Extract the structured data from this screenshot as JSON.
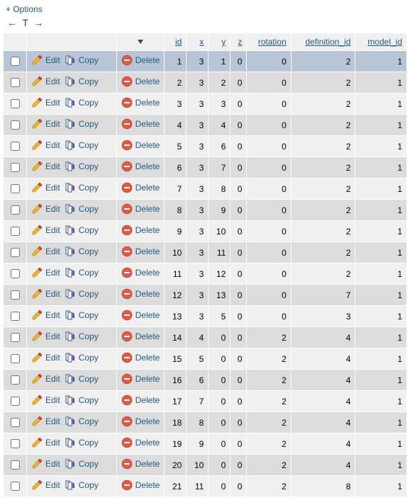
{
  "optionsLabel": "+ Options",
  "toolbar": {
    "leftArrow": "←",
    "tSymbol": "T",
    "rightArrow": "→"
  },
  "actions": {
    "edit": "Edit",
    "copy": "Copy",
    "delete": "Delete"
  },
  "columns": [
    "id",
    "x",
    "y",
    "z",
    "rotation",
    "definition_id",
    "model_id"
  ],
  "highlightRow": 0,
  "rows": [
    {
      "id": 1,
      "x": 3,
      "y": 1,
      "z": 0,
      "rotation": 0,
      "definition_id": 2,
      "model_id": 1
    },
    {
      "id": 2,
      "x": 3,
      "y": 2,
      "z": 0,
      "rotation": 0,
      "definition_id": 2,
      "model_id": 1
    },
    {
      "id": 3,
      "x": 3,
      "y": 3,
      "z": 0,
      "rotation": 0,
      "definition_id": 2,
      "model_id": 1
    },
    {
      "id": 4,
      "x": 3,
      "y": 4,
      "z": 0,
      "rotation": 0,
      "definition_id": 2,
      "model_id": 1
    },
    {
      "id": 5,
      "x": 3,
      "y": 6,
      "z": 0,
      "rotation": 0,
      "definition_id": 2,
      "model_id": 1
    },
    {
      "id": 6,
      "x": 3,
      "y": 7,
      "z": 0,
      "rotation": 0,
      "definition_id": 2,
      "model_id": 1
    },
    {
      "id": 7,
      "x": 3,
      "y": 8,
      "z": 0,
      "rotation": 0,
      "definition_id": 2,
      "model_id": 1
    },
    {
      "id": 8,
      "x": 3,
      "y": 9,
      "z": 0,
      "rotation": 0,
      "definition_id": 2,
      "model_id": 1
    },
    {
      "id": 9,
      "x": 3,
      "y": 10,
      "z": 0,
      "rotation": 0,
      "definition_id": 2,
      "model_id": 1
    },
    {
      "id": 10,
      "x": 3,
      "y": 11,
      "z": 0,
      "rotation": 0,
      "definition_id": 2,
      "model_id": 1
    },
    {
      "id": 11,
      "x": 3,
      "y": 12,
      "z": 0,
      "rotation": 0,
      "definition_id": 2,
      "model_id": 1
    },
    {
      "id": 12,
      "x": 3,
      "y": 13,
      "z": 0,
      "rotation": 0,
      "definition_id": 7,
      "model_id": 1
    },
    {
      "id": 13,
      "x": 3,
      "y": 5,
      "z": 0,
      "rotation": 0,
      "definition_id": 3,
      "model_id": 1
    },
    {
      "id": 14,
      "x": 4,
      "y": 0,
      "z": 0,
      "rotation": 2,
      "definition_id": 4,
      "model_id": 1
    },
    {
      "id": 15,
      "x": 5,
      "y": 0,
      "z": 0,
      "rotation": 2,
      "definition_id": 4,
      "model_id": 1
    },
    {
      "id": 16,
      "x": 6,
      "y": 0,
      "z": 0,
      "rotation": 2,
      "definition_id": 4,
      "model_id": 1
    },
    {
      "id": 17,
      "x": 7,
      "y": 0,
      "z": 0,
      "rotation": 2,
      "definition_id": 4,
      "model_id": 1
    },
    {
      "id": 18,
      "x": 8,
      "y": 0,
      "z": 0,
      "rotation": 2,
      "definition_id": 4,
      "model_id": 1
    },
    {
      "id": 19,
      "x": 9,
      "y": 0,
      "z": 0,
      "rotation": 2,
      "definition_id": 4,
      "model_id": 1
    },
    {
      "id": 20,
      "x": 10,
      "y": 0,
      "z": 0,
      "rotation": 2,
      "definition_id": 4,
      "model_id": 1
    },
    {
      "id": 21,
      "x": 11,
      "y": 0,
      "z": 0,
      "rotation": 2,
      "definition_id": 8,
      "model_id": 1
    }
  ]
}
